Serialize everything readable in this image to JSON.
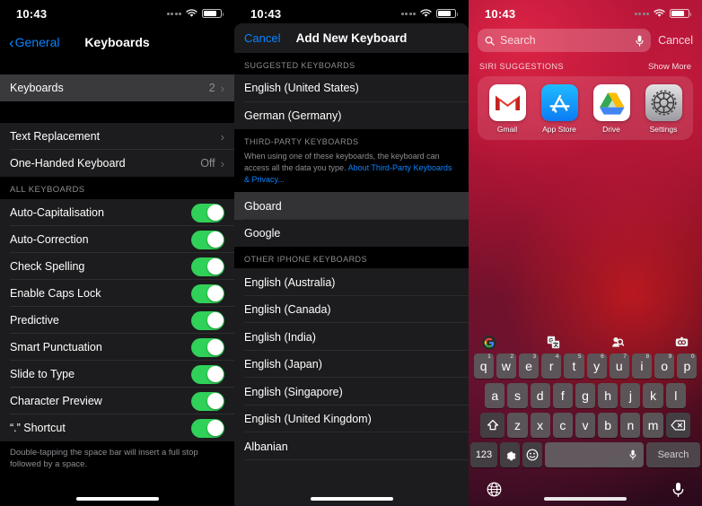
{
  "status_bar": {
    "time": "10:43",
    "wifi_icon": "wifi-icon",
    "battery_icon": "battery-icon",
    "cellular_icon": "cellular-dots-icon"
  },
  "panel_settings": {
    "back_label": "General",
    "title": "Keyboards",
    "rows_top": [
      {
        "label": "Keyboards",
        "value": "2",
        "chevron": "›",
        "selected": true
      }
    ],
    "rows_mid": [
      {
        "label": "Text Replacement",
        "value": "",
        "chevron": "›"
      },
      {
        "label": "One-Handed Keyboard",
        "value": "Off",
        "chevron": "›"
      }
    ],
    "section_header": "ALL KEYBOARDS",
    "toggles": [
      {
        "label": "Auto-Capitalisation",
        "on": true
      },
      {
        "label": "Auto-Correction",
        "on": true
      },
      {
        "label": "Check Spelling",
        "on": true
      },
      {
        "label": "Enable Caps Lock",
        "on": true
      },
      {
        "label": "Predictive",
        "on": true
      },
      {
        "label": "Smart Punctuation",
        "on": true
      },
      {
        "label": "Slide to Type",
        "on": true
      },
      {
        "label": "Character Preview",
        "on": true
      },
      {
        "label": "“.” Shortcut",
        "on": true
      }
    ],
    "footnote": "Double-tapping the space bar will insert a full stop followed by a space."
  },
  "panel_add_keyboard": {
    "cancel_label": "Cancel",
    "title": "Add New Keyboard",
    "suggested_header": "SUGGESTED KEYBOARDS",
    "suggested": [
      "English (United States)",
      "German (Germany)"
    ],
    "third_party_header": "THIRD-PARTY KEYBOARDS",
    "third_party_note": "When using one of these keyboards, the keyboard can access all the data you type. ",
    "third_party_link": "About Third-Party Keyboards & Privacy...",
    "third_party": [
      {
        "label": "Gboard",
        "highlighted": true
      },
      {
        "label": "Google",
        "highlighted": false
      }
    ],
    "other_header": "OTHER IPHONE KEYBOARDS",
    "other": [
      "English (Australia)",
      "English (Canada)",
      "English (India)",
      "English (Japan)",
      "English (Singapore)",
      "English (United Kingdom)",
      "Albanian"
    ]
  },
  "panel_spotlight": {
    "search_placeholder": "Search",
    "search_value": "",
    "search_icon": "magnifier-icon",
    "mic_icon": "microphone-icon",
    "cancel_label": "Cancel",
    "suggestions_header": "SIRI SUGGESTIONS",
    "show_more_label": "Show More",
    "apps": [
      {
        "name": "Gmail",
        "icon": "gmail-icon"
      },
      {
        "name": "App Store",
        "icon": "app-store-icon"
      },
      {
        "name": "Drive",
        "icon": "google-drive-icon"
      },
      {
        "name": "Settings",
        "icon": "settings-gear-icon"
      }
    ],
    "keyboard": {
      "toolbar_icons": [
        "google-logo-icon",
        "translate-icon",
        "sticker-search-icon",
        "gif-camera-icon"
      ],
      "row1": [
        {
          "k": "q",
          "n": "1"
        },
        {
          "k": "w",
          "n": "2"
        },
        {
          "k": "e",
          "n": "3"
        },
        {
          "k": "r",
          "n": "4"
        },
        {
          "k": "t",
          "n": "5"
        },
        {
          "k": "y",
          "n": "6"
        },
        {
          "k": "u",
          "n": "7"
        },
        {
          "k": "i",
          "n": "8"
        },
        {
          "k": "o",
          "n": "9"
        },
        {
          "k": "p",
          "n": "0"
        }
      ],
      "row2": [
        "a",
        "s",
        "d",
        "f",
        "g",
        "h",
        "j",
        "k",
        "l"
      ],
      "row3": [
        "z",
        "x",
        "c",
        "v",
        "b",
        "n",
        "m"
      ],
      "shift_icon": "shift-arrow-icon",
      "backspace_icon": "backspace-icon",
      "numbers_label": "123",
      "gear_icon": "gear-icon",
      "emoji_icon": "emoji-smiley-icon",
      "space_label": "",
      "space_mic_icon": "microphone-icon",
      "search_key_label": "Search",
      "globe_icon": "globe-icon",
      "dictation_icon": "microphone-icon"
    }
  },
  "colors": {
    "accent_blue": "#0a84ff",
    "toggle_green": "#30d158",
    "row_bg": "#1c1c1e",
    "selected_row": "#3a3a3c",
    "secondary_text": "#8e8e93"
  }
}
